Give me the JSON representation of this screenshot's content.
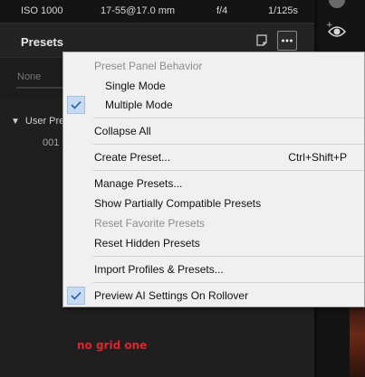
{
  "info_bar": {
    "iso": "ISO 1000",
    "lens": "17-55@17.0 mm",
    "aperture": "f/4",
    "shutter": "1/125s"
  },
  "panel": {
    "title": "Presets",
    "select_value": "None",
    "group_label": "User Pre",
    "preset_item": "001"
  },
  "annotation": "no grid one",
  "menu": {
    "header": "Preset Panel Behavior",
    "single_mode": "Single Mode",
    "multiple_mode": "Multiple Mode",
    "collapse_all": "Collapse All",
    "create_preset": "Create Preset...",
    "create_preset_shortcut": "Ctrl+Shift+P",
    "manage_presets": "Manage Presets...",
    "show_partially": "Show Partially Compatible Presets",
    "reset_favorite": "Reset Favorite Presets",
    "reset_hidden": "Reset Hidden Presets",
    "import_profiles": "Import Profiles & Presets...",
    "preview_ai": "Preview AI Settings On Rollover"
  },
  "colors": {
    "menu_bg": "#f0f0f0",
    "check_highlight": "#c6dbf1",
    "check_mark": "#1f5fa8",
    "annotation": "#e0242a"
  },
  "icons": {
    "check": "checkmark-icon",
    "more": "ellipsis-icon",
    "doc": "document-icon",
    "eye": "eye-icon"
  }
}
